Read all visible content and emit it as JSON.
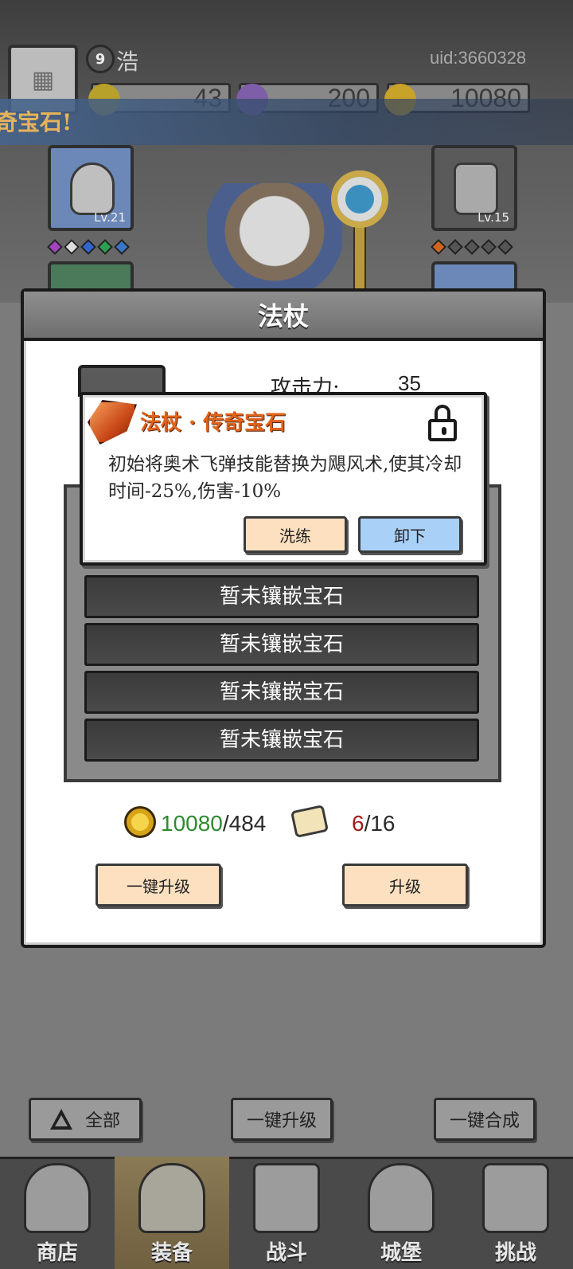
{
  "header": {
    "player_level": "9",
    "player_name": "浩",
    "uid": "uid:3660328",
    "currency": {
      "gems": "43",
      "crystals": "200",
      "coins": "10080"
    }
  },
  "banner": {
    "text": "奇宝石!"
  },
  "equipment": {
    "left_slot_level": "Lv.21",
    "right_slot_level": "Lv.15"
  },
  "dialog": {
    "title": "法杖",
    "attack_label": "攻击力:",
    "attack_value": "35",
    "gem_slots": [
      "暂未镶嵌宝石",
      "暂未镶嵌宝石",
      "暂未镶嵌宝石",
      "暂未镶嵌宝石"
    ],
    "resources": {
      "coins_owned": "10080",
      "coins_sep_cost": "/484",
      "scrolls_owned": "6",
      "scrolls_sep_needed": "/16"
    },
    "buttons": {
      "upgrade_all": "一键升级",
      "upgrade": "升级"
    }
  },
  "gem_popup": {
    "title": "法杖 · 传奇宝石",
    "description": "初始将奥术飞弹技能替换为飓风术,使其冷却时间-25%,伤害-10%",
    "refine_label": "洗练",
    "remove_label": "卸下",
    "title_color": "#e2631b"
  },
  "actions": {
    "filter_all": "全部",
    "upgrade_all": "一键升级",
    "merge_all": "一键合成"
  },
  "nav": {
    "items": [
      {
        "label": "商店",
        "icon": "shop-icon"
      },
      {
        "label": "装备",
        "icon": "backpack-icon"
      },
      {
        "label": "战斗",
        "icon": "crossed-swords-icon"
      },
      {
        "label": "城堡",
        "icon": "castle-icon"
      },
      {
        "label": "挑战",
        "icon": "locked-challenge-icon"
      }
    ],
    "active": "装备"
  }
}
